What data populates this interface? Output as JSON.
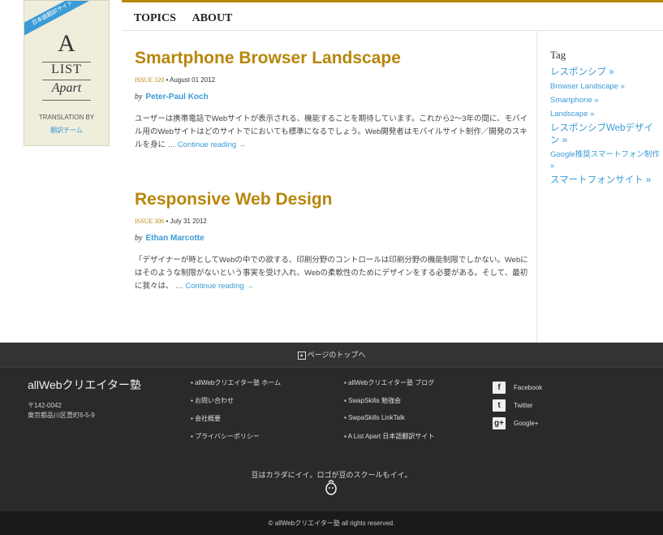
{
  "logo": {
    "ribbon": "日本語翻訳サイト",
    "line1": "A",
    "line2": "LIST",
    "line3": "Apart",
    "translation_by": "TRANSLATION BY",
    "team": "翻訳チーム"
  },
  "nav": {
    "topics": "TOPICS",
    "about": "ABOUT"
  },
  "articles": [
    {
      "title": "Smartphone Browser Landscape",
      "issue": "ISSUE 320",
      "date": "• August 01 2012",
      "by": "by",
      "author": "Peter-Paul Koch",
      "excerpt": "ユーザーは携帯電話でWebサイトが表示される、機能することを期待しています。これから2～3年の間に、モバイル用のWebサイトはどのサイトでにおいても標準になるでしょう。Web開発者はモバイルサイト制作／開発のスキルを身に …",
      "more": "Continue reading →"
    },
    {
      "title": "Responsive Web Design",
      "issue": "ISSUE 306",
      "date": "• July 31 2012",
      "by": "by",
      "author": "Ethan Marcotte",
      "excerpt": "「デザイナーが時としてWebの中での欲する、印刷分野のコントロールは印刷分野の機能制限でしかない。Webにはそのような制限がないという事実を受け入れ、Webの柔軟性のためにデザインをする必要がある。そして、最初に我々は、 …",
      "more": "Continue reading →"
    }
  ],
  "sidebar": {
    "heading": "Tag",
    "tags": [
      "レスポンシブ »",
      "Browser Landscape »",
      "Smartphone »",
      "Landscape »",
      "レスポンシブWebデザイン »",
      "Google推奨スマートフォン制作 »",
      "スマートフォンサイト »"
    ]
  },
  "footer": {
    "to_top": "ページのトップへ",
    "brand": "allWebクリエイター塾",
    "postal": "〒142-0042",
    "address": "東京都品川区豊町6-5-9",
    "col1": [
      "allWebクリエイター塾 ホーム",
      "お問い合わせ",
      "会社概要",
      "プライバシーポリシー"
    ],
    "col2": [
      "allWebクリエイター塾 ブログ",
      "SwapSkills 勉強会",
      "SwpaSkills LinkTalk",
      "A List Apart 日本語翻訳サイト"
    ],
    "social": [
      {
        "icon": "facebook-icon",
        "glyph": "f",
        "label": "Facebook"
      },
      {
        "icon": "twitter-icon",
        "glyph": "t",
        "label": "Twitter"
      },
      {
        "icon": "google-plus-icon",
        "glyph": "g+",
        "label": "Google+"
      }
    ],
    "tagline": "豆はカラダにイイ。ロゴが豆のスクールもイイ。",
    "copyright": "© allWebクリエイター塾 all rights reserved."
  }
}
